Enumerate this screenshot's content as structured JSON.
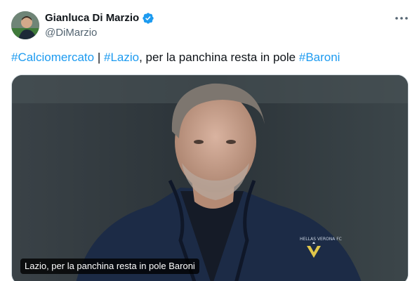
{
  "author": {
    "display_name": "Gianluca Di Marzio",
    "handle": "@DiMarzio",
    "verified_color": "#1d9bf0"
  },
  "tweet": {
    "segments": [
      {
        "text": "#Calciomercato",
        "type": "hashtag"
      },
      {
        "text": " | ",
        "type": "text"
      },
      {
        "text": "#Lazio",
        "type": "hashtag"
      },
      {
        "text": ", per la panchina resta in pole ",
        "type": "text"
      },
      {
        "text": "#Baroni",
        "type": "hashtag"
      }
    ]
  },
  "media": {
    "caption": "Lazio, per la panchina resta in pole Baroni",
    "badge_text": "HELLAS VERONA FC"
  },
  "icons": {
    "more": "more-horizontal-icon",
    "verified": "verified-badge-icon"
  }
}
